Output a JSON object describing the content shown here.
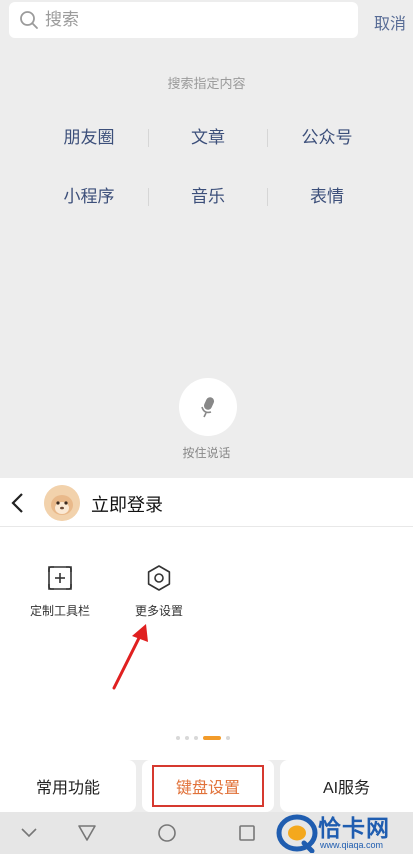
{
  "search": {
    "placeholder": "搜索",
    "cancel_label": "取消"
  },
  "hint": "搜索指定内容",
  "categories": {
    "row1": [
      "朋友圈",
      "文章",
      "公众号"
    ],
    "row2": [
      "小程序",
      "音乐",
      "表情"
    ]
  },
  "voice": {
    "label": "按住说话"
  },
  "keyboard_panel": {
    "login_label": "立即登录",
    "tools": [
      {
        "label": "定制工具栏",
        "icon": "add-square-icon"
      },
      {
        "label": "更多设置",
        "icon": "gear-icon"
      }
    ],
    "page_dots": {
      "count": 5,
      "active_index": 3
    },
    "tabs": [
      {
        "label": "常用功能"
      },
      {
        "label": "键盘设置",
        "highlighted": true
      },
      {
        "label": "AI服务"
      }
    ]
  },
  "colors": {
    "link": "#576b95",
    "category": "#3c4f7a",
    "highlight_border": "#d6392f",
    "highlight_text": "#e1723a",
    "active_dot": "#f29b2a"
  },
  "watermark": {
    "text": "恰卡网",
    "url": "www.qiaqa.com"
  }
}
